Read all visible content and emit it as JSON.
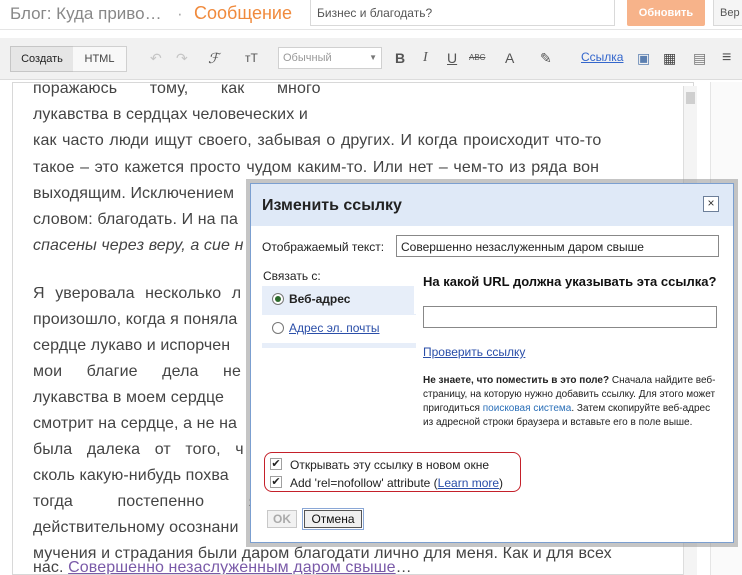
{
  "header": {
    "blog_title": "Блог: Куда приво…",
    "separator": "·",
    "post_kind": "Сообщение",
    "post_title": "Бизнес и благодать?",
    "publish_label": "Обновить",
    "preview_label": "Вер"
  },
  "toolbar": {
    "compose_label": "Создать",
    "html_label": "HTML",
    "undo_icon": "↶",
    "redo_icon": "↷",
    "font_icon": "ℱ",
    "font_size_icon": "тТ",
    "format_select": "Обычный",
    "bold_icon": "B",
    "italic_icon": "I",
    "underline_icon": "U",
    "strike_icon": "ABC",
    "text_color_icon": "A",
    "highlight_icon": "✎",
    "link_label": "Ссылка",
    "image_icon": "▣",
    "video_icon": "▦",
    "jump_icon": "▤",
    "align_icon": "≡"
  },
  "post": {
    "lines": [
      "поражаюсь тому, как много",
      "лукавства в сердцах человеческих и",
      "как часто люди ищут своего, забывая о других. И когда происходит что-то",
      "такое – это кажется просто чудом каким-то. Или нет – чем-то из ряда вон",
      "выходящим. Исключением",
      "словом: благодать. И на па",
      "спасены через веру, а сие н",
      "",
      "Я уверовала несколько л",
      "произошло, когда я поняла",
      "сердце лукаво и испорчен",
      "мои благие дела не",
      "лукавства в моем сердце",
      "смотрит на сердце, а не на",
      "была далека от того, ч",
      "сколь какую-нибудь похва",
      "тогда постепенно я",
      "действительному осознани",
      "мучения и страдания были даром благодати лично для меня. Как и для всех"
    ],
    "last_line_prefix": "нас.",
    "last_line_link": "Совершенно незаслуженным даром свыше",
    "last_line_suffix": "…"
  },
  "dialog": {
    "title": "Изменить ссылку",
    "close_icon": "×",
    "display_text_label": "Отображаемый текст:",
    "display_text_value": "Совершенно незаслуженным даром свыше",
    "link_to_label": "Связать с:",
    "tab_web": "Веб-адрес",
    "tab_email": "Адрес эл. почты",
    "url_question": "На какой URL должна указывать эта ссылка?",
    "url_value": "",
    "test_link": "Проверить ссылку",
    "help_bold": "Не знаете, что поместить в это поле?",
    "help_text_1": " Сначала найдите веб-страницу, на которую нужно добавить ссылку. Для этого может пригодиться ",
    "help_highlight": "поисковая система",
    "help_text_2": ". Затем скопируйте веб-адрес из адресной строки браузера и вставьте его в поле выше.",
    "open_new_window": "Открывать эту ссылку в новом окне",
    "nofollow_prefix": "Add 'rel=nofollow' attribute (",
    "learn_more": "Learn more",
    "nofollow_suffix": ")",
    "ok_label": "OK",
    "cancel_label": "Отмена"
  },
  "colors": {
    "accent_orange": "#f08a3c",
    "link_blue": "#2a4ea8",
    "dialog_header": "#dfe9f7",
    "highlight_border": "#c4202a"
  }
}
